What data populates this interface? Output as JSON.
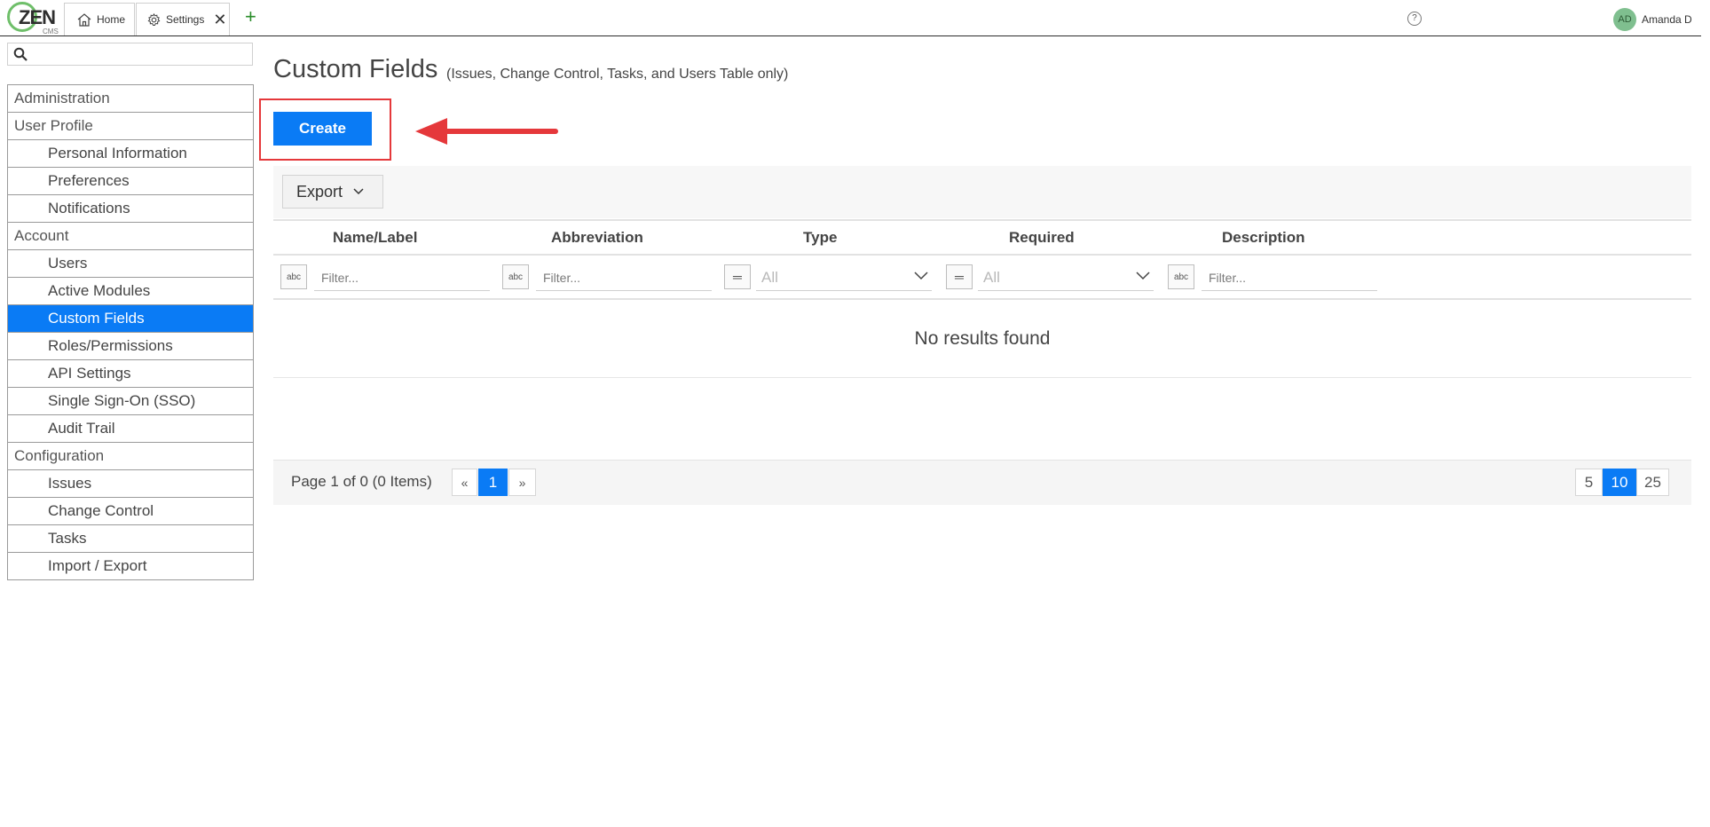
{
  "logo": {
    "text": "ZEN",
    "sub": "CMS"
  },
  "tabs": [
    {
      "label": "Home",
      "icon": "home-icon"
    },
    {
      "label": "Settings",
      "icon": "gear-icon"
    }
  ],
  "header": {
    "help": "?",
    "user_initials": "AD",
    "user_name": "Amanda D"
  },
  "sidebar": {
    "search_placeholder": "",
    "items": [
      {
        "label": "Administration",
        "level": "section"
      },
      {
        "label": "User Profile",
        "level": "section"
      },
      {
        "label": "Personal Information",
        "level": "sub"
      },
      {
        "label": "Preferences",
        "level": "sub"
      },
      {
        "label": "Notifications",
        "level": "sub"
      },
      {
        "label": "Account",
        "level": "section"
      },
      {
        "label": "Users",
        "level": "sub"
      },
      {
        "label": "Active Modules",
        "level": "sub"
      },
      {
        "label": "Custom Fields",
        "level": "sub",
        "active": true
      },
      {
        "label": "Roles/Permissions",
        "level": "sub"
      },
      {
        "label": "API Settings",
        "level": "sub"
      },
      {
        "label": "Single Sign-On (SSO)",
        "level": "sub"
      },
      {
        "label": "Audit Trail",
        "level": "sub"
      },
      {
        "label": "Configuration",
        "level": "section"
      },
      {
        "label": "Issues",
        "level": "sub"
      },
      {
        "label": "Change Control",
        "level": "sub"
      },
      {
        "label": "Tasks",
        "level": "sub"
      },
      {
        "label": "Import / Export",
        "level": "sub"
      }
    ]
  },
  "main": {
    "title": "Custom Fields",
    "subtitle": "(Issues, Change Control, Tasks, and Users Table only)",
    "create_label": "Create",
    "export_label": "Export",
    "columns": [
      "Name/Label",
      "Abbreviation",
      "Type",
      "Required",
      "Description"
    ],
    "filter_placeholder": "Filter...",
    "filter_icon": "abc",
    "select_value": "All",
    "empty_text": "No results found",
    "pager": {
      "info": "Page 1 of 0 (0 Items)",
      "prev": "«",
      "current": "1",
      "next": "»",
      "sizes": [
        "5",
        "10",
        "25"
      ],
      "active_size": "10"
    }
  },
  "colors": {
    "accent": "#0a7bf5",
    "highlight": "#e5383b",
    "logo_ring": "#6fbf6a"
  }
}
